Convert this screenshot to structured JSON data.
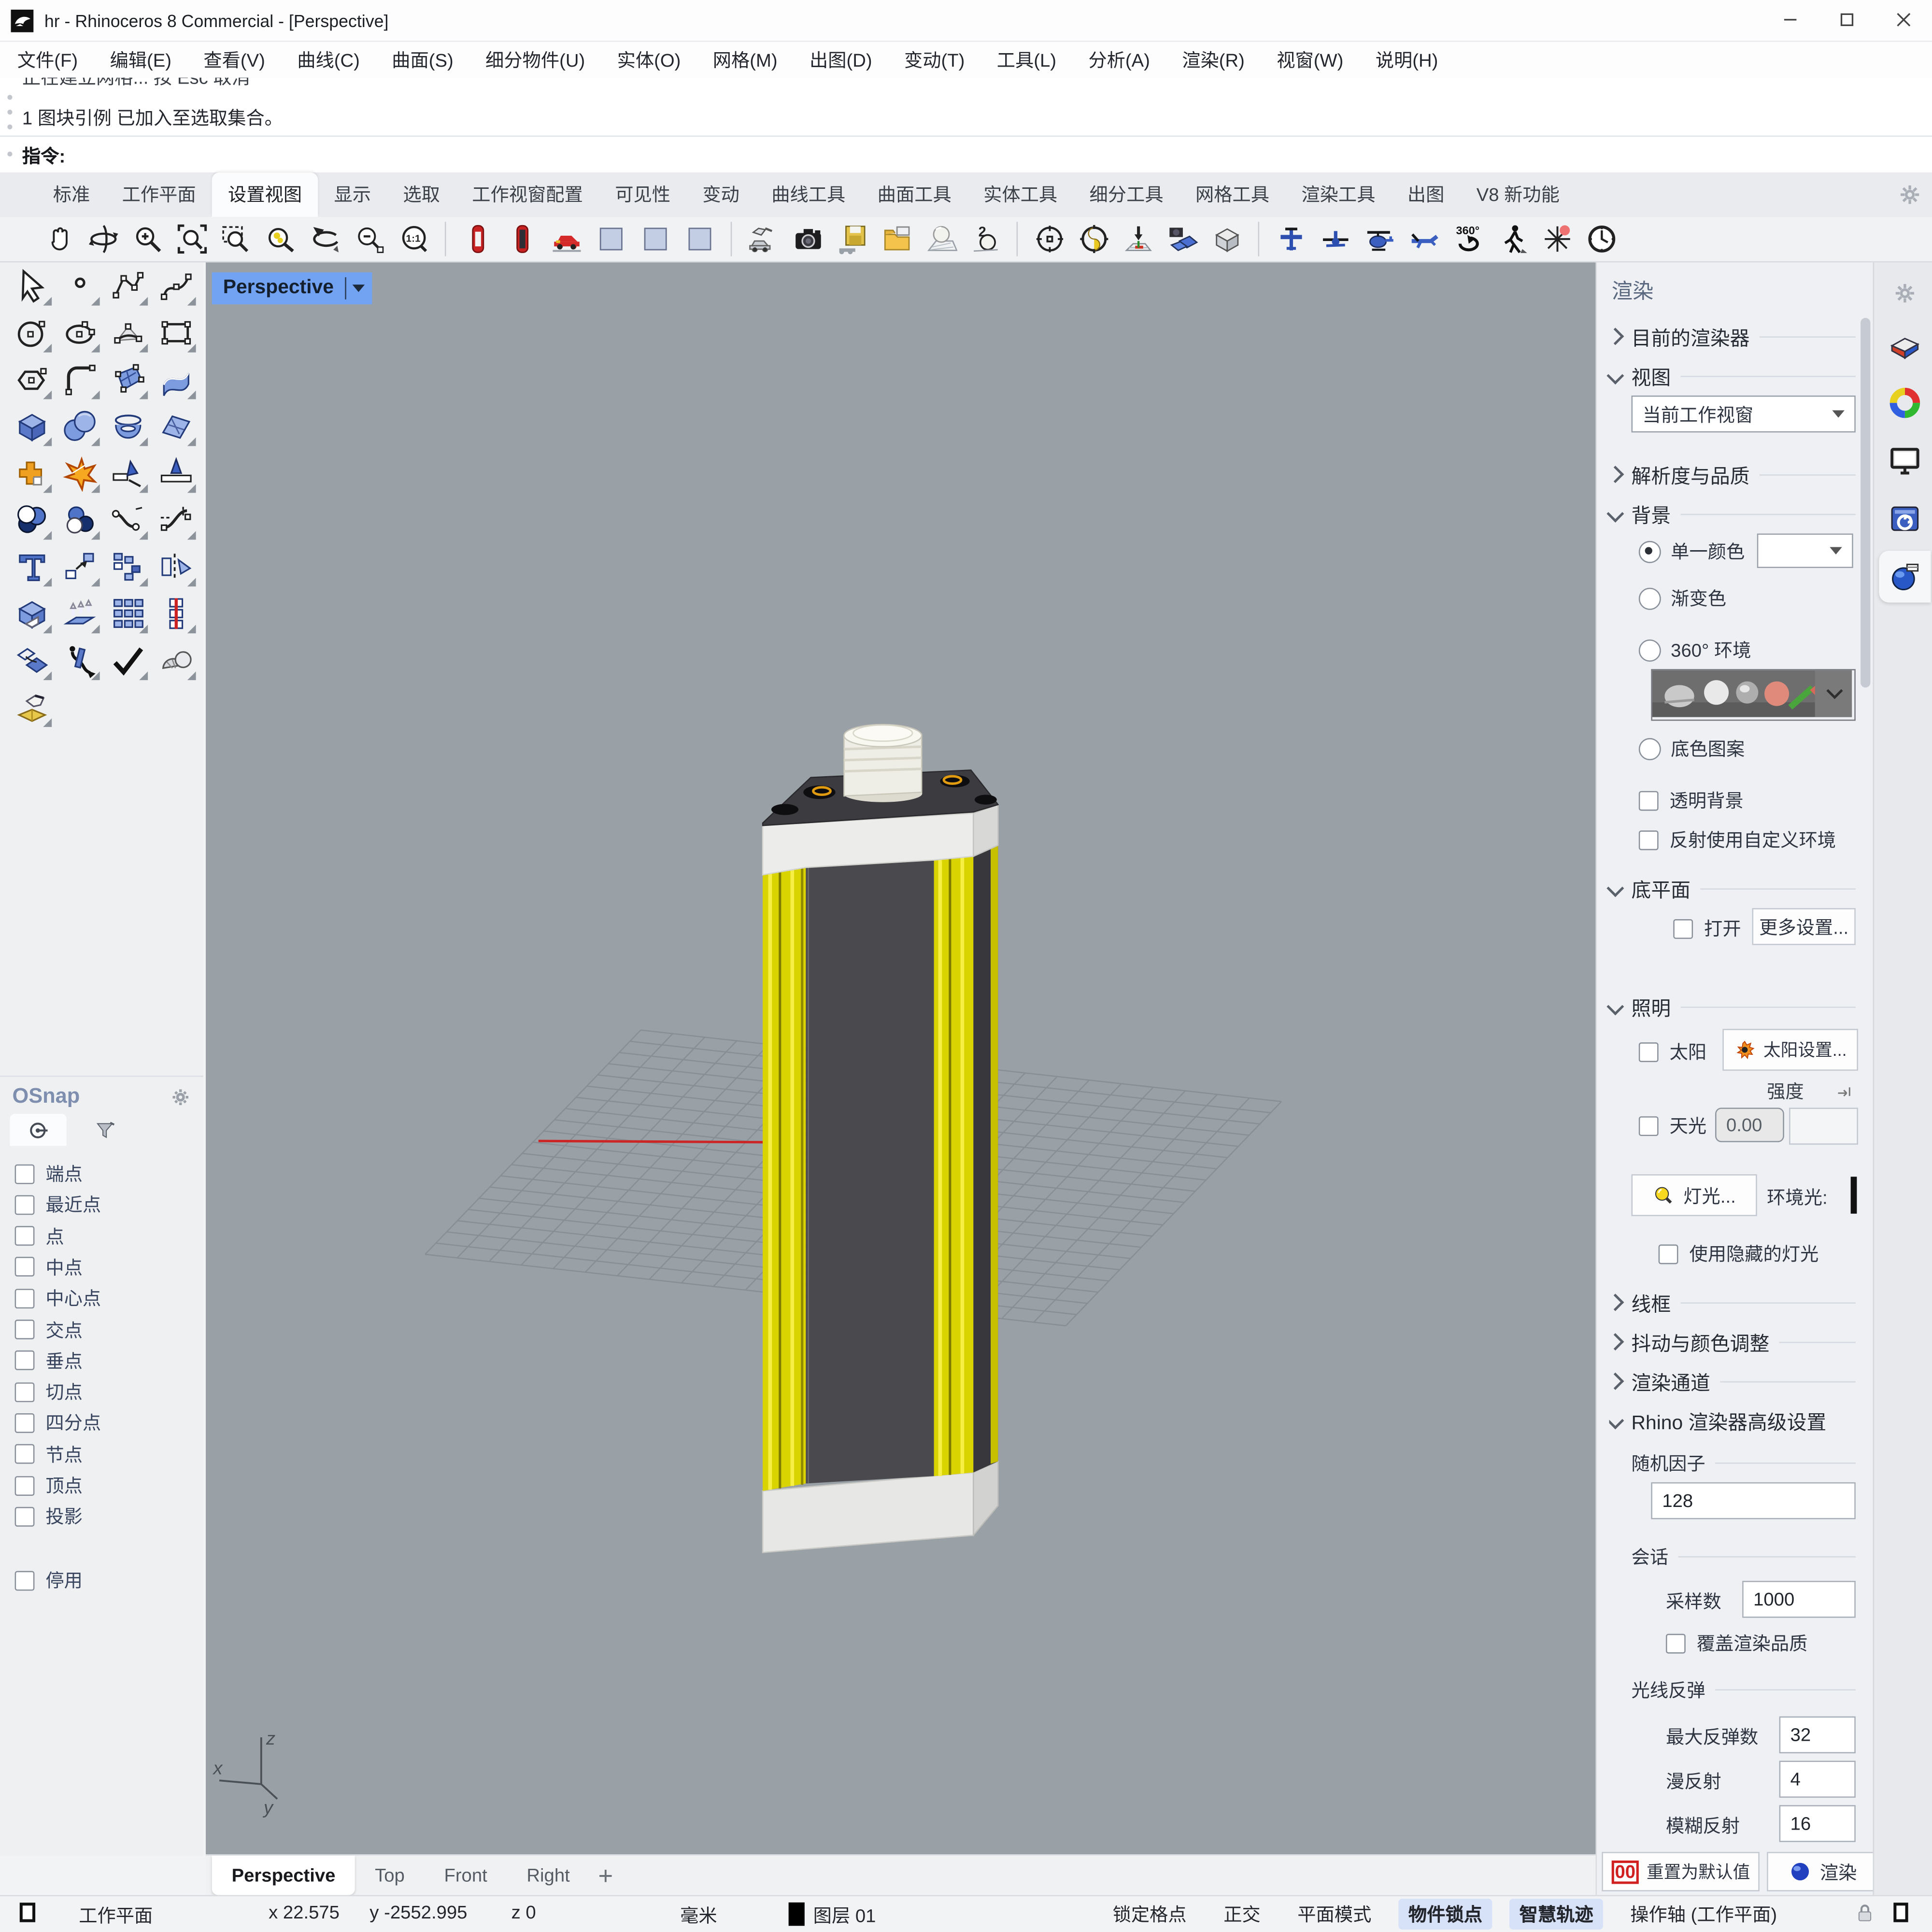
{
  "window": {
    "title": "hr - Rhinoceros 8 Commercial - [Perspective]"
  },
  "menu": {
    "items": [
      "文件(F)",
      "编辑(E)",
      "查看(V)",
      "曲线(C)",
      "曲面(S)",
      "细分物件(U)",
      "实体(O)",
      "网格(M)",
      "出图(D)",
      "变动(T)",
      "工具(L)",
      "分析(A)",
      "渲染(R)",
      "视窗(W)",
      "说明(H)"
    ]
  },
  "command": {
    "clipped_line": "正在建立网格... 按 Esc 取消",
    "history_line": "1 图块引例 已加入至选取集合。",
    "prompt_label": "指令:"
  },
  "ribbon_tabs": {
    "active": "设置视图",
    "items": [
      "标准",
      "工作平面",
      "设置视图",
      "显示",
      "选取",
      "工作视窗配置",
      "可见性",
      "变动",
      "曲线工具",
      "曲面工具",
      "实体工具",
      "细分工具",
      "网格工具",
      "渲染工具",
      "出图",
      "V8 新功能"
    ]
  },
  "toolbar": {
    "groups": [
      [
        "pan-hand",
        "rotate-view",
        "zoom-dynamic",
        "zoom-window",
        "zoom-selected",
        "zoom-extents",
        "undo-view",
        "zoom-out",
        "zoom-one-to-one"
      ],
      [
        "display-wireframe",
        "display-shaded-dark",
        "display-shaded-car",
        "display-rendered-car",
        "display-ghosted-car",
        "display-raytraced-car"
      ],
      [
        "restore-view-car",
        "named-view-camera",
        "save-view-floppy",
        "open-view-folder",
        "environment-sphere",
        "two-point-perspective"
      ],
      [
        "target-point",
        "compass-orientation",
        "place-camera",
        "show-camera-frustum",
        "viewport-layout-cube"
      ],
      [
        "airplane-top",
        "airplane-front",
        "helicopter",
        "airplane-side",
        "turntable-360",
        "walk-mode",
        "smart-track-star",
        "clock-timer"
      ]
    ]
  },
  "toolbox": {
    "rows": [
      [
        "select-arrow",
        "single-point",
        "polyline",
        "control-point-curve"
      ],
      [
        "circle",
        "ellipse",
        "arc",
        "rectangle"
      ],
      [
        "polygon",
        "fillet-curves",
        "surface-from-points",
        "loft-surface"
      ],
      [
        "box",
        "sphere",
        "torus",
        "patch-surface"
      ],
      [
        "join-puzzle",
        "explode",
        "trim",
        "split"
      ],
      [
        "boolean-union",
        "boolean-difference",
        "blend-curves",
        "adjustable-blend"
      ],
      [
        "text-object",
        "move",
        "copy-array",
        "mirror"
      ],
      [
        "cage-edit",
        "extrude-surface",
        "rectangular-array",
        "linear-array"
      ],
      [
        "flow-along-surface",
        "bend",
        "check-select",
        "mesh-primitives"
      ],
      [
        "extract-render-mesh"
      ]
    ]
  },
  "osnap": {
    "title": "OSnap",
    "items": [
      "端点",
      "最近点",
      "点",
      "中点",
      "中心点",
      "交点",
      "垂点",
      "切点",
      "四分点",
      "节点",
      "顶点",
      "投影"
    ],
    "disable_label": "停用"
  },
  "viewport": {
    "label": "Perspective",
    "axis_labels": {
      "x": "x",
      "y": "y",
      "z": "z"
    },
    "view_tabs": [
      "Perspective",
      "Top",
      "Front",
      "Right"
    ],
    "active_view_tab": "Perspective"
  },
  "render_panel": {
    "title": "渲染",
    "current_renderer_label": "目前的渲染器",
    "view_label": "视图",
    "view_dropdown_value": "当前工作视窗",
    "resolution_label": "解析度与品质",
    "background_label": "背景",
    "single_color_label": "单一颜色",
    "gradient_label": "渐变色",
    "environment_label": "360° 环境",
    "base_pattern_label": "底色图案",
    "transparent_label": "透明背景",
    "reflection_label": "反射使用自定义环境",
    "ground_plane_label": "底平面",
    "ground_on_label": "打开",
    "more_settings_label": "更多设置...",
    "lighting_label": "照明",
    "sun_label": "太阳",
    "sun_settings_label": "太阳设置...",
    "intensity_label": "强度",
    "skylight_label": "天光",
    "skylight_value": "0.00",
    "lights_label": "灯光...",
    "ambient_label": "环境光:",
    "hidden_lights_label": "使用隐藏的灯光",
    "wireframe_label": "线框",
    "dither_label": "抖动与颜色调整",
    "channels_label": "渲染通道",
    "advanced_label": "Rhino 渲染器高级设置",
    "seed_label": "随机因子",
    "seed_value": "128",
    "session_label": "会话",
    "samples_label": "采样数",
    "samples_value": "1000",
    "override_label": "覆盖渲染品质",
    "bounces_label": "光线反弹",
    "max_bounces_label": "最大反弹数",
    "max_bounces_value": "32",
    "diffuse_label": "漫反射",
    "diffuse_value": "4",
    "glossy_label": "模糊反射",
    "glossy_value": "16",
    "reset_label": "重置为默认值",
    "render_button_label": "渲染"
  },
  "right_strip": {
    "icons": [
      "render-properties-cake",
      "color-wheel",
      "display-monitor",
      "help-panel",
      "libraries-sphere"
    ]
  },
  "status_bar": {
    "cplane_label": "工作平面",
    "x": "x 22.575",
    "y": "y -2552.995",
    "z": "z 0",
    "units": "毫米",
    "layer_label": "图层 01",
    "toggles": [
      {
        "label": "锁定格点",
        "active": false
      },
      {
        "label": "正交",
        "active": false
      },
      {
        "label": "平面模式",
        "active": false
      },
      {
        "label": "物件锁点",
        "active": true
      },
      {
        "label": "智慧轨迹",
        "active": true
      },
      {
        "label": "操作轴 (工作平面)",
        "active": false
      }
    ]
  },
  "colors": {
    "viewport_bg": "#9aa1a6",
    "viewport_label_bg": "#72a2f2",
    "object_yellow": "#d9d300",
    "object_dark": "#4a4a4e",
    "grid_line": "#878f95",
    "red_axis": "#cc2525",
    "toggle_active_bg": "#d7e1f7"
  }
}
